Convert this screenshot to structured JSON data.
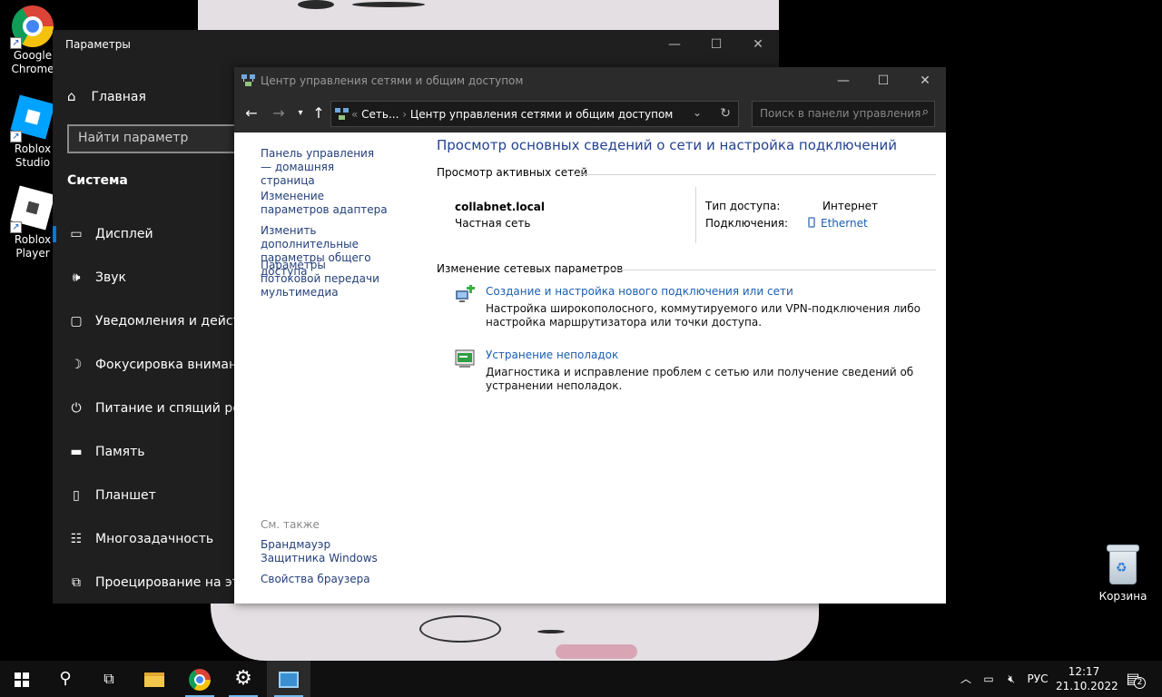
{
  "desktop": {
    "icons": [
      {
        "label": "Google Chrome",
        "icon": "chrome-icon"
      },
      {
        "label": "Roblox Studio",
        "icon": "roblox-studio-icon"
      },
      {
        "label": "Roblox Player",
        "icon": "roblox-player-icon"
      }
    ],
    "recycle_bin": {
      "label": "Корзина",
      "icon": "recycle-bin-icon"
    }
  },
  "settings": {
    "title": "Параметры",
    "home_label": "Главная",
    "search_placeholder": "Найти параметр",
    "section_title": "Система",
    "nav": [
      {
        "label": "Дисплей",
        "icon": "display-icon"
      },
      {
        "label": "Звук",
        "icon": "sound-icon"
      },
      {
        "label": "Уведомления и действия",
        "icon": "notifications-icon"
      },
      {
        "label": "Фокусировка внимания",
        "icon": "focus-assist-icon"
      },
      {
        "label": "Питание и спящий режим",
        "icon": "power-icon"
      },
      {
        "label": "Память",
        "icon": "storage-icon"
      },
      {
        "label": "Планшет",
        "icon": "tablet-icon"
      },
      {
        "label": "Многозадачность",
        "icon": "multitasking-icon"
      },
      {
        "label": "Проецирование на этот компьютер",
        "icon": "projecting-icon"
      }
    ]
  },
  "network_center": {
    "title": "Центр управления сетями и общим доступом",
    "breadcrumb": {
      "root": "Сеть...",
      "current": "Центр управления сетями и общим доступом"
    },
    "search_placeholder": "Поиск в панели управления",
    "left_links": [
      "Панель управления — домашняя страница",
      "Изменение параметров адаптера",
      "Изменить дополнительные параметры общего доступа",
      "Параметры потоковой передачи мультимедиа"
    ],
    "see_also_title": "См. также",
    "see_also_links": [
      "Брандмауэр Защитника Windows",
      "Свойства браузера"
    ],
    "heading": "Просмотр основных сведений о сети и настройка подключений",
    "active_networks_title": "Просмотр активных сетей",
    "network_name": "collabnet.local",
    "network_type": "Частная сеть",
    "access_type_label": "Тип доступа:",
    "access_type_value": "Интернет",
    "connections_label": "Подключения:",
    "connections_value": "Ethernet",
    "change_settings_title": "Изменение сетевых параметров",
    "tasks": [
      {
        "title": "Создание и настройка нового подключения или сети",
        "desc": "Настройка широкополосного, коммутируемого или VPN-подключения либо настройка маршрутизатора или точки доступа.",
        "icon": "new-connection-icon"
      },
      {
        "title": "Устранение неполадок",
        "desc": "Диагностика и исправление проблем с сетью или получение сведений об устранении неполадок.",
        "icon": "troubleshoot-icon"
      }
    ]
  },
  "taskbar": {
    "language": "РУС",
    "time": "12:17",
    "date": "21.10.2022",
    "notifications_count": "2"
  },
  "colors": {
    "accent": "#0078d7",
    "link": "#1a5fb4",
    "heading": "#234290"
  }
}
